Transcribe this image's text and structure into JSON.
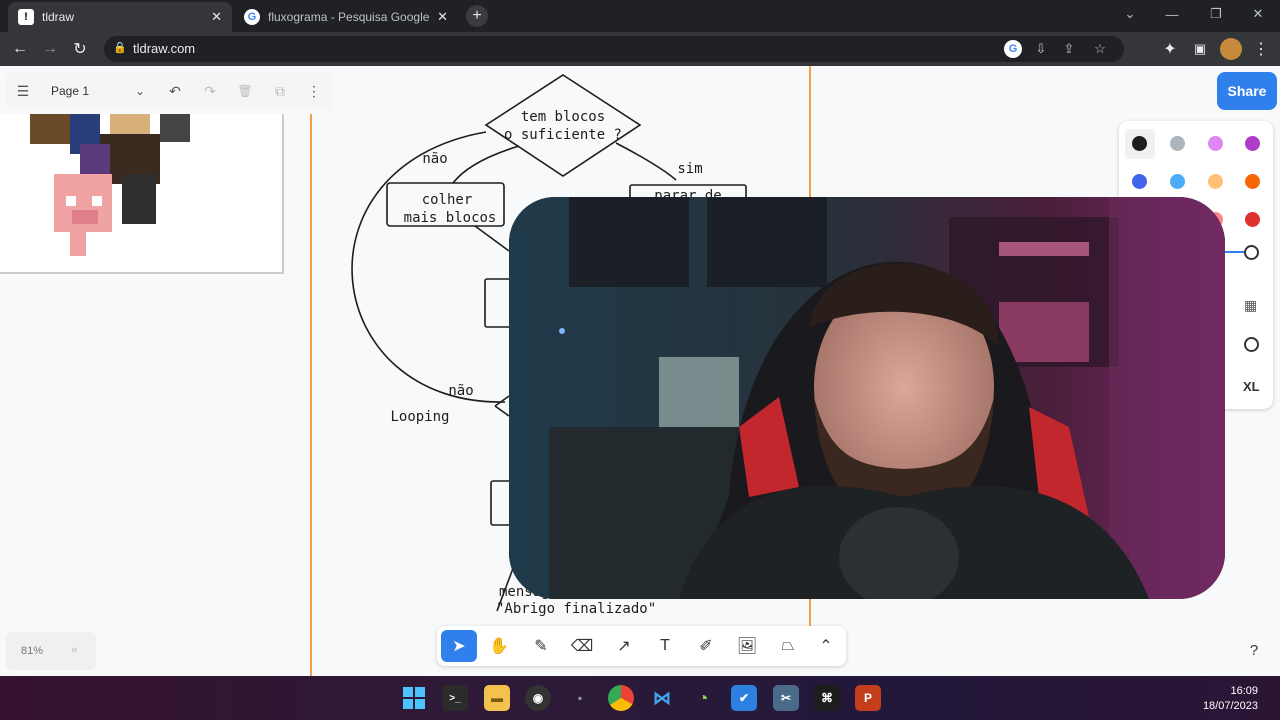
{
  "browser": {
    "tabs": [
      {
        "title": "tldraw",
        "active": true
      },
      {
        "title": "fluxograma - Pesquisa Google",
        "active": false
      }
    ],
    "url": "tldraw.com"
  },
  "app": {
    "page_label": "Page 1",
    "share_label": "Share",
    "zoom": "81%",
    "help": "?",
    "size_label": "XL",
    "colors": [
      "#1d1d1d",
      "#adb5bd",
      "#e085f4",
      "#ae3ec9",
      "#4263eb",
      "#4dabf7",
      "#ffc078",
      "#f76707",
      "#e03131",
      "#ff8787",
      "#099268",
      "#40c057"
    ]
  },
  "flowchart": {
    "decision1": [
      "tem blocos",
      "o suficiente ?"
    ],
    "yes": "sim",
    "no1": "não",
    "process1": [
      "colher",
      "mais blocos"
    ],
    "process2": "parar de",
    "no2": "não",
    "looping": "Looping",
    "message1": "mensag",
    "message2": "\"Abrigo finalizado\""
  },
  "taskbar": {
    "time": "16:09",
    "date": "18/07/2023"
  }
}
